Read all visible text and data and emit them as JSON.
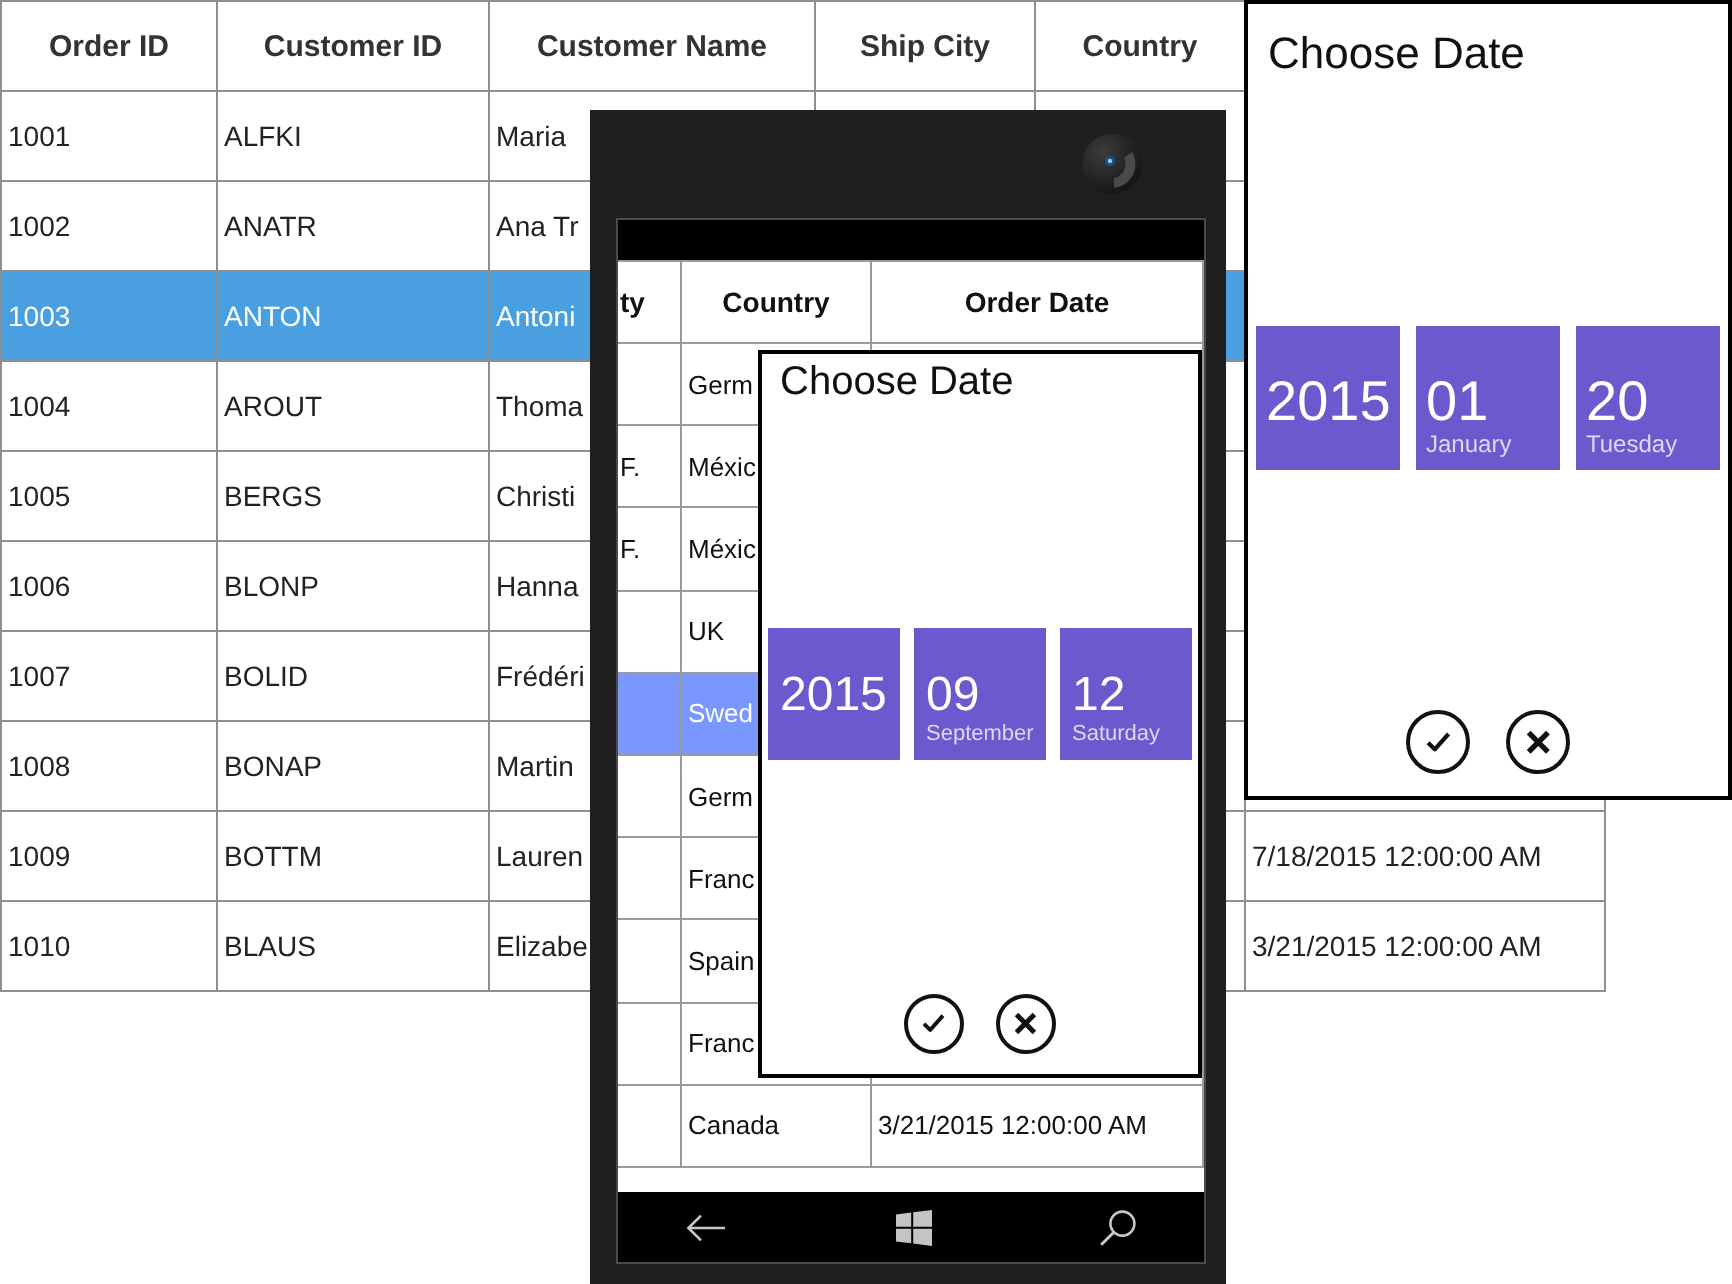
{
  "grid": {
    "columns": [
      "Order ID",
      "Customer ID",
      "Customer Name",
      "Ship City",
      "Country"
    ],
    "rows": [
      {
        "order_id": "1001",
        "customer_id": "ALFKI",
        "customer_name": "Maria",
        "selected": false
      },
      {
        "order_id": "1002",
        "customer_id": "ANATR",
        "customer_name": "Ana Tr",
        "selected": false
      },
      {
        "order_id": "1003",
        "customer_id": "ANTON",
        "customer_name": "Antoni",
        "selected": true
      },
      {
        "order_id": "1004",
        "customer_id": "AROUT",
        "customer_name": "Thoma",
        "selected": false
      },
      {
        "order_id": "1005",
        "customer_id": "BERGS",
        "customer_name": "Christi",
        "selected": false
      },
      {
        "order_id": "1006",
        "customer_id": "BLONP",
        "customer_name": "Hanna",
        "selected": false
      },
      {
        "order_id": "1007",
        "customer_id": "BOLID",
        "customer_name": "Frédéri",
        "selected": false
      },
      {
        "order_id": "1008",
        "customer_id": "BONAP",
        "customer_name": "Martin",
        "selected": false
      },
      {
        "order_id": "1009",
        "customer_id": "BOTTM",
        "customer_name": "Lauren",
        "column_6": "7/18/2015 12:00:00 AM",
        "selected": false
      },
      {
        "order_id": "1010",
        "customer_id": "BLAUS",
        "customer_name": "Elizabe",
        "column_6": "3/21/2015 12:00:00 AM",
        "selected": false
      }
    ]
  },
  "phone": {
    "grid": {
      "columns": [
        "ty",
        "Country",
        "Order Date"
      ],
      "rows": [
        {
          "country": "Germ",
          "selected": false
        },
        {
          "column_1": "F.",
          "country": "Méxic",
          "selected": false
        },
        {
          "column_1": "F.",
          "country": "Méxic",
          "selected": false
        },
        {
          "country": "UK",
          "selected": false
        },
        {
          "country": "Swed",
          "selected": true
        },
        {
          "country": "Germ",
          "selected": false
        },
        {
          "country": "Franc",
          "selected": false
        },
        {
          "country": "Spain",
          "selected": false
        },
        {
          "country": "Franc",
          "selected": false
        },
        {
          "country": "Canada",
          "order_date": "3/21/2015 12:00:00 AM",
          "selected": false
        }
      ]
    },
    "date_picker": {
      "title": "Choose Date",
      "tiles": [
        {
          "number": "2015"
        },
        {
          "number": "09",
          "caption": "September"
        },
        {
          "number": "12",
          "caption": "Saturday"
        }
      ]
    }
  },
  "date_picker": {
    "title": "Choose Date",
    "tiles": [
      {
        "number": "2015"
      },
      {
        "number": "01",
        "caption": "January"
      },
      {
        "number": "20",
        "caption": "Tuesday"
      }
    ]
  }
}
